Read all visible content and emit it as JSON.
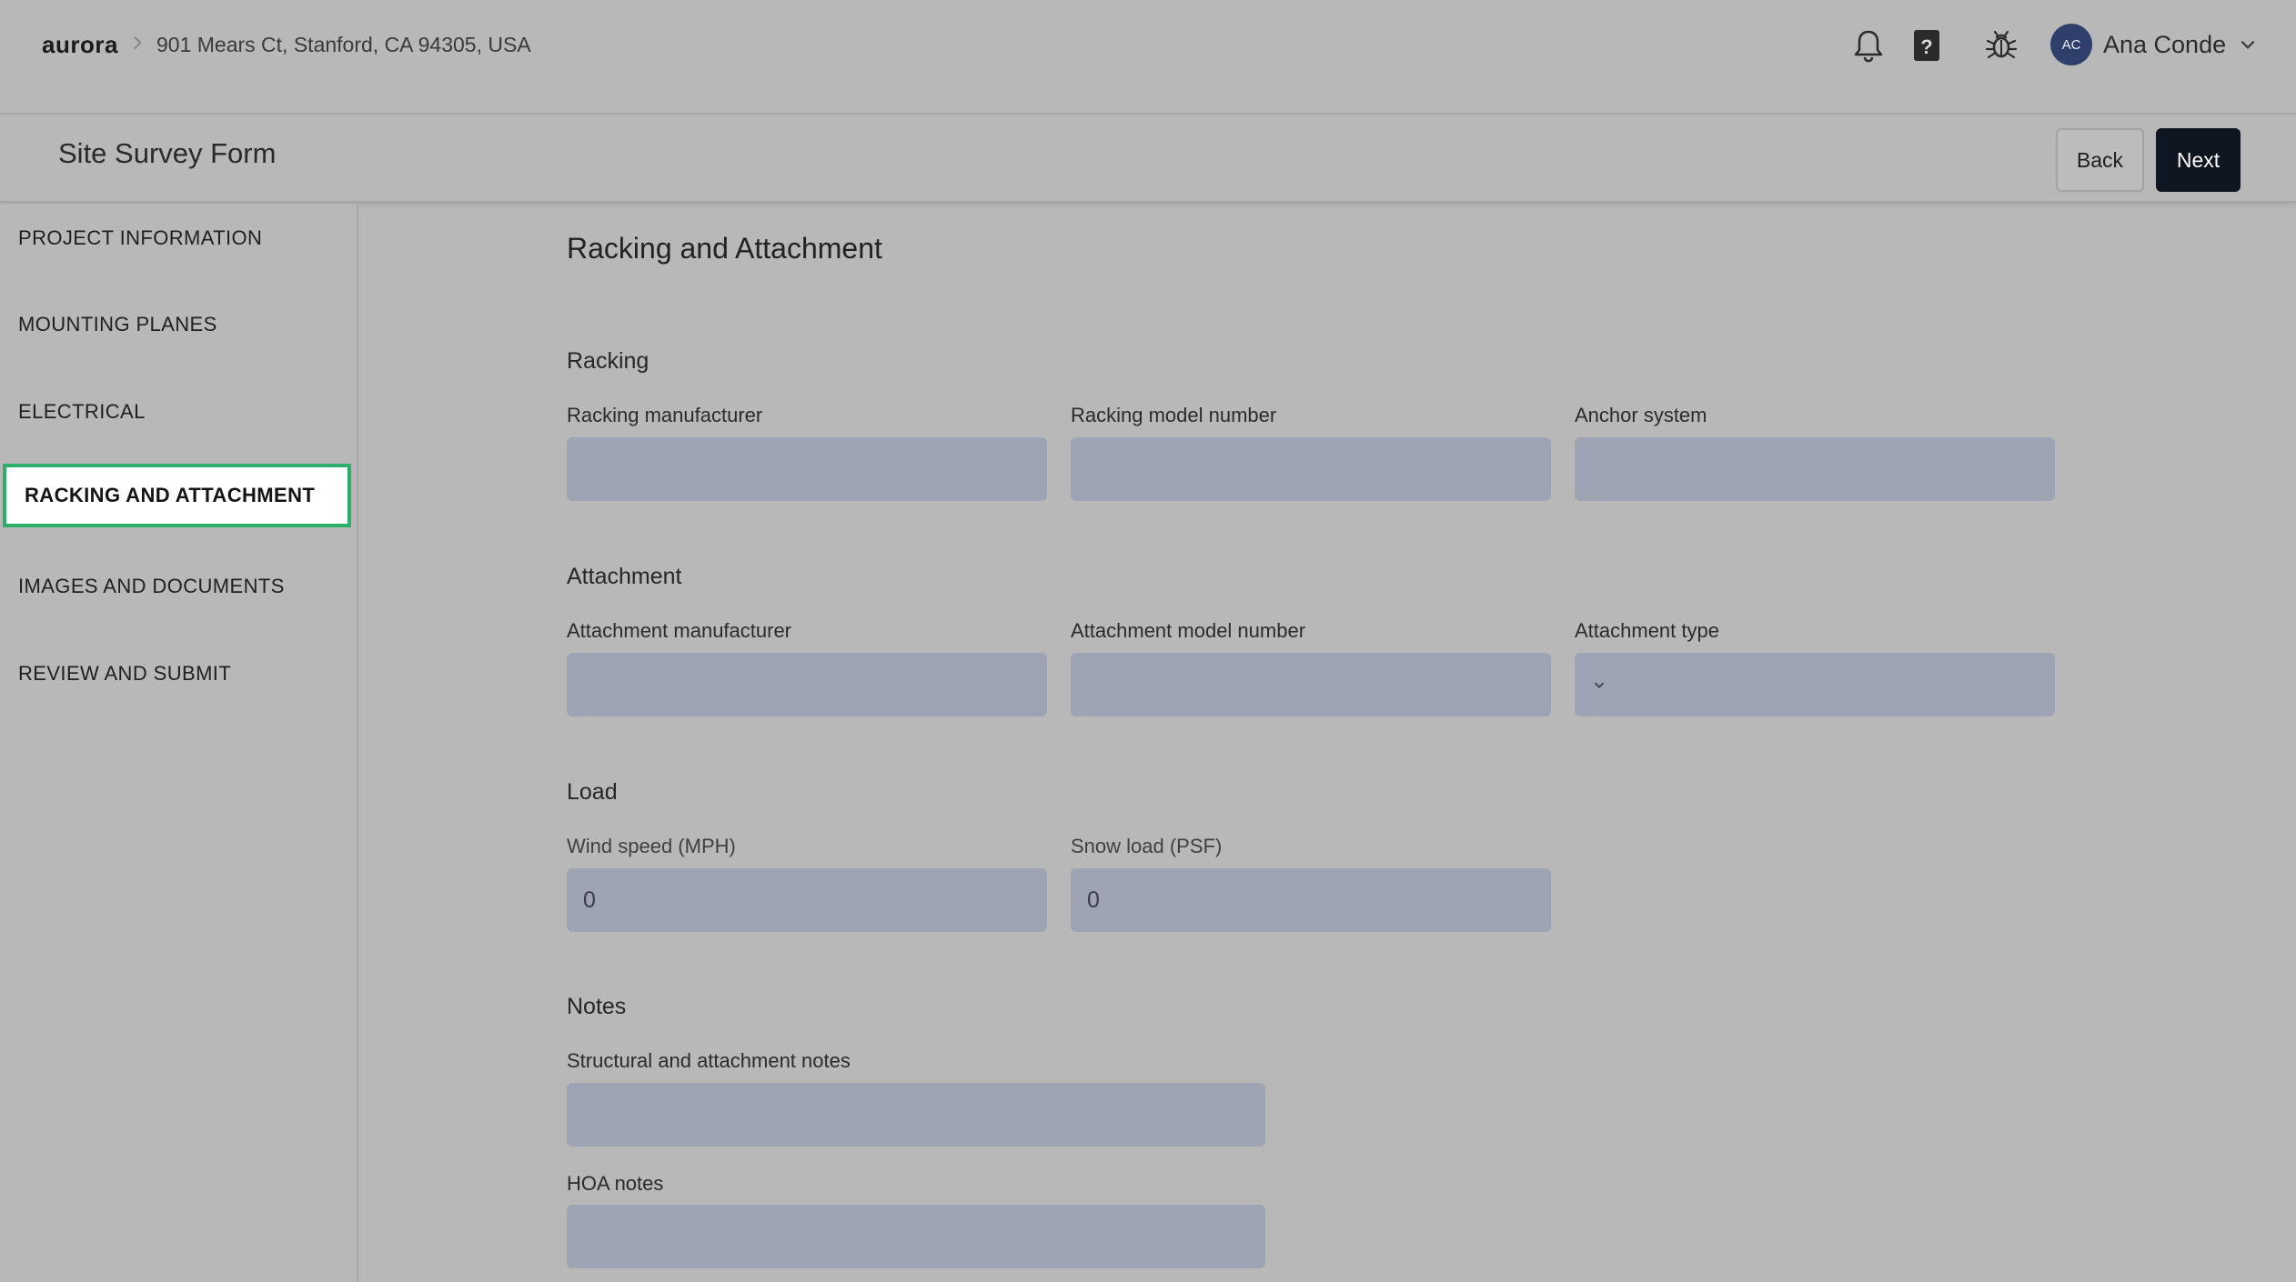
{
  "header": {
    "logo": "aurora",
    "address": "901 Mears Ct, Stanford, CA 94305, USA",
    "user": {
      "initials": "AC",
      "name": "Ana Conde"
    }
  },
  "subheader": {
    "title": "Site Survey Form",
    "back_label": "Back",
    "next_label": "Next"
  },
  "sidebar": {
    "items": [
      {
        "label": "PROJECT INFORMATION"
      },
      {
        "label": "MOUNTING PLANES"
      },
      {
        "label": "ELECTRICAL"
      },
      {
        "label": "RACKING AND ATTACHMENT",
        "active": true
      },
      {
        "label": "IMAGES AND DOCUMENTS"
      },
      {
        "label": "REVIEW AND SUBMIT"
      }
    ]
  },
  "main": {
    "title": "Racking and Attachment",
    "racking": {
      "heading": "Racking",
      "manufacturer_label": "Racking manufacturer",
      "manufacturer_value": "",
      "model_label": "Racking model number",
      "model_value": "",
      "anchor_label": "Anchor system",
      "anchor_value": ""
    },
    "attachment": {
      "heading": "Attachment",
      "manufacturer_label": "Attachment manufacturer",
      "manufacturer_value": "",
      "model_label": "Attachment model number",
      "model_value": "",
      "type_label": "Attachment type",
      "type_value": ""
    },
    "load": {
      "heading": "Load",
      "wind_label": "Wind speed (MPH)",
      "wind_value": "0",
      "snow_label": "Snow load (PSF)",
      "snow_value": "0"
    },
    "notes": {
      "heading": "Notes",
      "structural_label": "Structural and attachment notes",
      "structural_value": "",
      "hoa_label": "HOA notes",
      "hoa_value": ""
    }
  },
  "colors": {
    "accent_active": "#2eae6b",
    "primary_button": "#0f1622",
    "input_fill": "#9ea4b3",
    "avatar": "#2e3f6b"
  }
}
